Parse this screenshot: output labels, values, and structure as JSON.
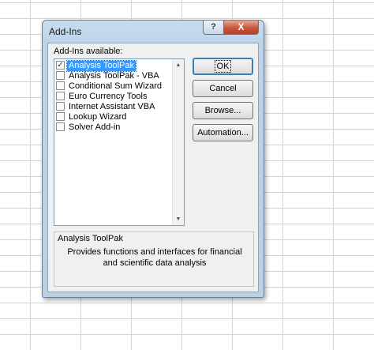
{
  "dialog": {
    "title": "Add-Ins",
    "help_button": "?",
    "close_button": "X",
    "available_label": "Add-Ins available:",
    "items": [
      {
        "label": "Analysis ToolPak",
        "checked": true,
        "selected": true
      },
      {
        "label": "Analysis ToolPak - VBA",
        "checked": false,
        "selected": false
      },
      {
        "label": "Conditional Sum Wizard",
        "checked": false,
        "selected": false
      },
      {
        "label": "Euro Currency Tools",
        "checked": false,
        "selected": false
      },
      {
        "label": "Internet Assistant VBA",
        "checked": false,
        "selected": false
      },
      {
        "label": "Lookup Wizard",
        "checked": false,
        "selected": false
      },
      {
        "label": "Solver Add-in",
        "checked": false,
        "selected": false
      }
    ],
    "buttons": {
      "ok": "OK",
      "cancel": "Cancel",
      "browse": "Browse...",
      "automation": "Automation..."
    },
    "description": {
      "title": "Analysis ToolPak",
      "text": "Provides functions and interfaces for financial and scientific data analysis"
    }
  }
}
